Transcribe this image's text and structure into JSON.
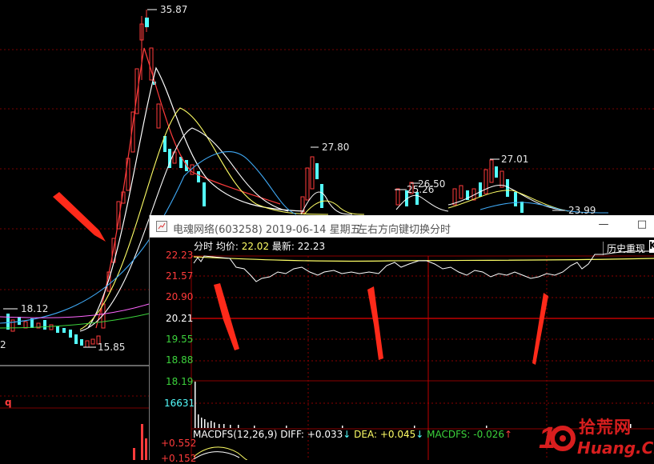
{
  "main_chart": {
    "labels": {
      "high_peak": "35.87",
      "peak2": "27.80",
      "peak3": "26.50",
      "peak3b": "25.26",
      "peak4": "27.01",
      "price_right": "23.99",
      "price_left": "18.12",
      "low": "15.85",
      "left_cut": "2",
      "sub_tag": "q"
    }
  },
  "popup": {
    "icon": "stock-window-icon",
    "title": "电魂网络(603258) 2019-06-14 星期五",
    "hint": "左右方向键切换分时",
    "minimize": "—",
    "maximize": "□",
    "info": {
      "label_time": "分时",
      "avg_label": "均价:",
      "avg_value": "22.02",
      "last_label": "最新:",
      "last_value": "22.23"
    },
    "history_button": "历史重现",
    "k_button": "K",
    "price_axis": [
      "22.23",
      "21.57",
      "20.90",
      "20.21",
      "19.55",
      "18.88",
      "18.19"
    ],
    "volume_axis": "16631",
    "macd": {
      "name": "MACDFS(12,26,9)",
      "diff_label": "DIFF:",
      "diff_value": "+0.033",
      "dea_label": "DEA:",
      "dea_value": "+0.045",
      "macdfs_label": "MACDFS:",
      "macdfs_value": "-0.026",
      "axis_top": "+0.552",
      "axis_bottom": "+0.152"
    }
  },
  "watermark": {
    "number": "10",
    "cn": "拾荒网",
    "en": "Huang.CN"
  },
  "colors": {
    "up": "#ff3b3b",
    "down": "#54ffff",
    "ma_white": "#ffffff",
    "ma_yellow": "#ffff66",
    "ma_blue": "#3fa9f5",
    "ma_pink": "#ff66ff",
    "ma_green": "#3cd33c",
    "grid": "#8b0000",
    "annotation_arrow": "#ff2a1a"
  }
}
